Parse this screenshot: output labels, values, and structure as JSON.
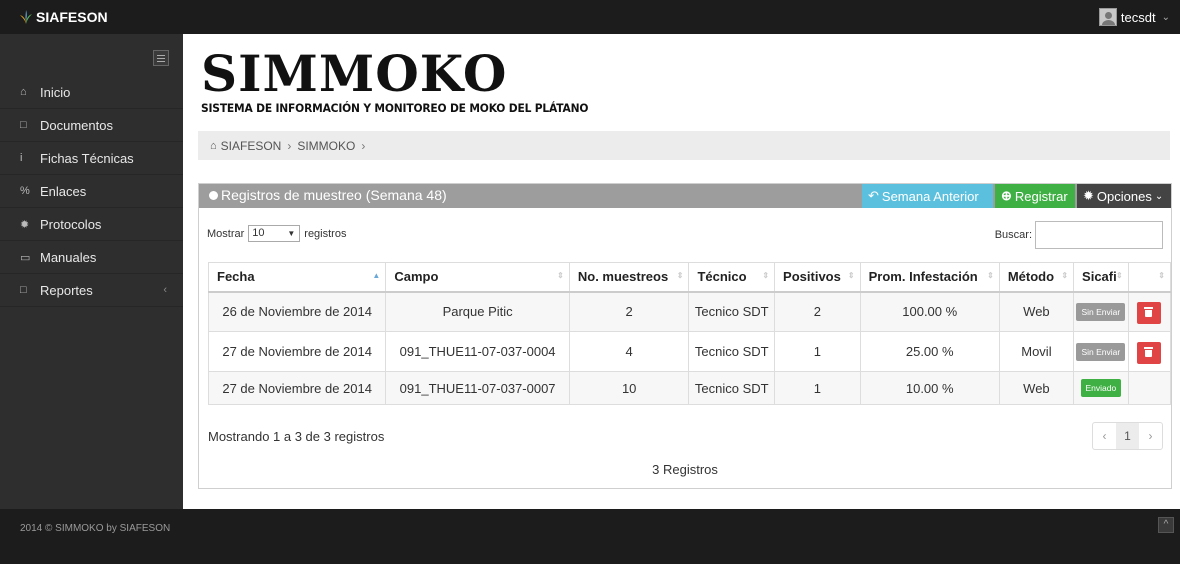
{
  "app": {
    "brand": "SIAFESON",
    "user": "tecsdt"
  },
  "sidebar": {
    "items": [
      {
        "label": "Inicio",
        "icon": "home-icon"
      },
      {
        "label": "Documentos",
        "icon": "folder-icon"
      },
      {
        "label": "Fichas Técnicas",
        "icon": "info-icon"
      },
      {
        "label": "Enlaces",
        "icon": "link-icon"
      },
      {
        "label": "Protocolos",
        "icon": "gear-icon"
      },
      {
        "label": "Manuales",
        "icon": "book-icon"
      },
      {
        "label": "Reportes",
        "icon": "file-icon"
      }
    ]
  },
  "header": {
    "title": "SIMMOKO",
    "subtitle": "SISTEMA DE INFORMACIÓN Y MONITOREO DE MOKO DEL PLÁTANO"
  },
  "breadcrumb": [
    "SIAFESON",
    "SIMMOKO"
  ],
  "panel": {
    "title": "Registros de muestreo (Semana 48)",
    "prev_label": "Semana Anterior",
    "register_label": "Registrar",
    "options_label": "Opciones"
  },
  "controls": {
    "show_label": "Mostrar",
    "page_size": "10",
    "records_label": "registros",
    "search_label": "Buscar:"
  },
  "table": {
    "columns": [
      "Fecha",
      "Campo",
      "No. muestreos",
      "Técnico",
      "Positivos",
      "Prom. Infestación",
      "Método",
      "Sicafi"
    ],
    "rows": [
      {
        "fecha": "26 de Noviembre de 2014",
        "campo": "Parque Pitic",
        "muestreos": "2",
        "tecnico": "Tecnico SDT",
        "positivos": "2",
        "infestacion": "100.00 %",
        "metodo": "Web",
        "sicafi": "Sin Enviar"
      },
      {
        "fecha": "27 de Noviembre de 2014",
        "campo": "091_THUE11-07-037-0004",
        "muestreos": "4",
        "tecnico": "Tecnico SDT",
        "positivos": "1",
        "infestacion": "25.00 %",
        "metodo": "Movil",
        "sicafi": "Sin Enviar"
      },
      {
        "fecha": "27 de Noviembre de 2014",
        "campo": "091_THUE11-07-037-0007",
        "muestreos": "10",
        "tecnico": "Tecnico SDT",
        "positivos": "1",
        "infestacion": "10.00 %",
        "metodo": "Web",
        "sicafi": "Enviado"
      }
    ]
  },
  "info": "Mostrando 1 a 3 de 3 registros",
  "pager": {
    "current": "1",
    "prev": "‹",
    "next": "›"
  },
  "total": "3 Registros",
  "footer": {
    "copyright": "2014 © SIMMOKO by SIAFESON"
  },
  "colors": {
    "info": "#5bc0de",
    "success": "#3fb044",
    "danger": "#e04444",
    "dark": "#1c1c1c"
  }
}
